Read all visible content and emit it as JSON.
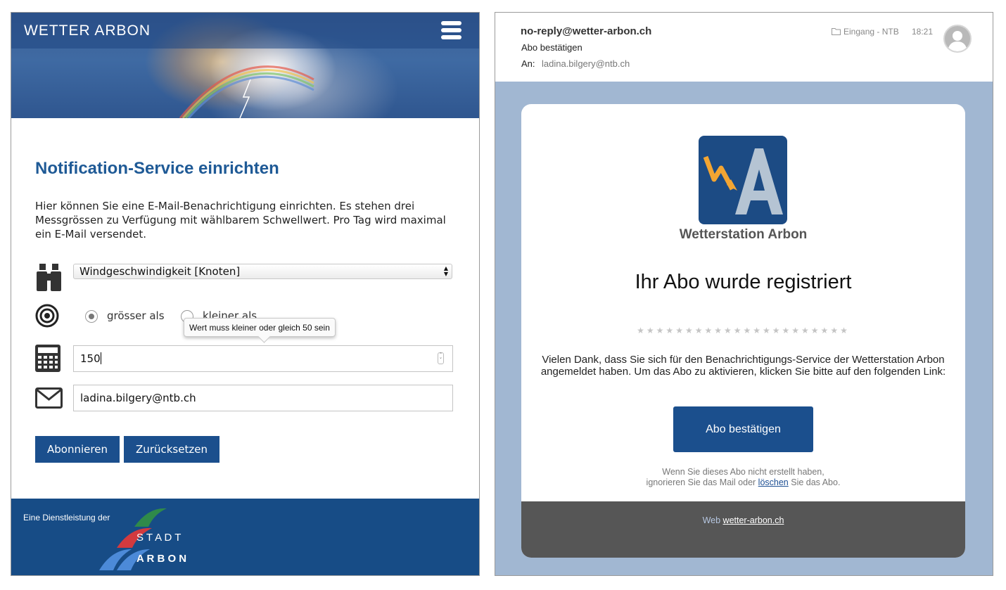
{
  "left": {
    "site_title": "WETTER ARBON",
    "heading": "Notification-Service einrichten",
    "intro_lines": [
      "Hier können Sie eine E-Mail-Benachrichtigung einrichten. Es stehen drei",
      "Messgrössen zu Verfügung mit wählbarem Schwellwert. Pro Tag wird maximal",
      "ein E-Mail versendet."
    ],
    "measure_select": {
      "value": "Windgeschwindigkeit [Knoten]"
    },
    "comparison": {
      "option_greater": "grösser als",
      "option_less": "kleiner als",
      "selected": "grösser als"
    },
    "tooltip": "Wert muss kleiner oder gleich 50 sein",
    "threshold_value": "150",
    "email_value": "ladina.bilgery@ntb.ch",
    "buttons": {
      "subscribe": "Abonnieren",
      "reset": "Zurücksetzen"
    },
    "footer": {
      "credit": "Eine Dienstleistung der",
      "logo_word_1": "S T A D T",
      "logo_word_2": "A R B O N"
    },
    "colors": {
      "primary_blue": "#1b4f8d",
      "footer_blue": "#174c86",
      "heading_blue": "#1f5a96"
    }
  },
  "right": {
    "from": "no-reply@wetter-arbon.ch",
    "subject": "Abo bestätigen",
    "to_label": "An:",
    "to": "ladina.bilgery@ntb.ch",
    "folder": "Eingang - NTB",
    "time": "18:21",
    "logo_text": "Wetterstation Arbon",
    "heading": "Ihr Abo wurde registriert",
    "stars": "★★★★★★★★★★★★★★★★★★★★★★",
    "body_lines": [
      "Vielen Dank, dass Sie sich für den Benachrichtigungs-Service der Wetterstation Arbon",
      "angemeldet haben. Um das Abo zu aktivieren, klicken Sie bitte auf den folgenden Link:"
    ],
    "confirm_button": "Abo bestätigen",
    "note_line1": "Wenn Sie dieses Abo nicht erstellt haben,",
    "note_line2_pre": "ignorieren Sie das Mail oder ",
    "note_link": "löschen",
    "note_line2_post": " Sie das Abo.",
    "footer_label": "Web ",
    "footer_link": "wetter-arbon.ch",
    "colors": {
      "backdrop": "#a1b7d2",
      "logo_tile": "#1c4b84",
      "logo_accent": "#f3a532",
      "footer_grey": "#565656"
    }
  }
}
